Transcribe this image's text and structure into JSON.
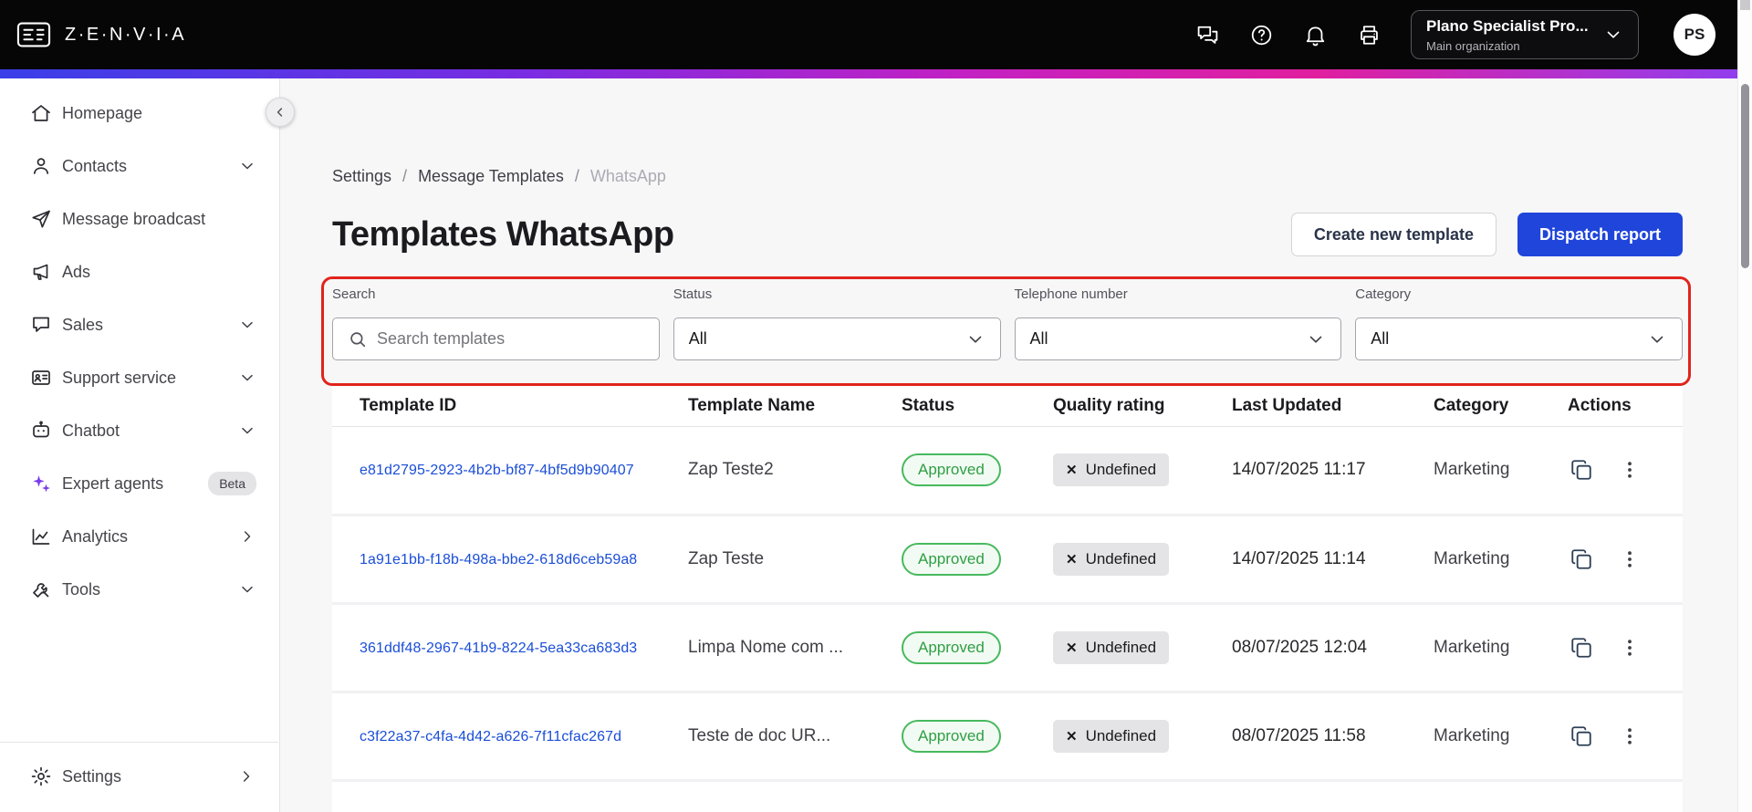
{
  "topbar": {
    "logo_text": "Z·E·N·V·I·A",
    "org_name": "Plano Specialist Pro...",
    "org_sub": "Main organization",
    "avatar_initials": "PS"
  },
  "sidebar": {
    "items": [
      {
        "label": "Homepage"
      },
      {
        "label": "Contacts"
      },
      {
        "label": "Message broadcast"
      },
      {
        "label": "Ads"
      },
      {
        "label": "Sales"
      },
      {
        "label": "Support service"
      },
      {
        "label": "Chatbot"
      },
      {
        "label": "Expert agents",
        "badge": "Beta"
      },
      {
        "label": "Analytics"
      },
      {
        "label": "Tools"
      }
    ],
    "settings_label": "Settings"
  },
  "breadcrumb": {
    "items": [
      "Settings",
      "Message Templates",
      "WhatsApp"
    ],
    "separator": "/"
  },
  "page": {
    "title": "Templates WhatsApp",
    "create_button_label": "Create new template",
    "dispatch_button_label": "Dispatch report"
  },
  "filters": {
    "search": {
      "label": "Search",
      "placeholder": "Search templates"
    },
    "status": {
      "label": "Status",
      "value": "All"
    },
    "telephone": {
      "label": "Telephone number",
      "value": "All"
    },
    "category": {
      "label": "Category",
      "value": "All"
    }
  },
  "table": {
    "headers": [
      "Template ID",
      "Template Name",
      "Status",
      "Quality rating",
      "Last Updated",
      "Category",
      "Actions"
    ],
    "rows": [
      {
        "id": "e81d2795-2923-4b2b-bf87-4bf5d9b90407",
        "name": "Zap Teste2",
        "status": "Approved",
        "quality": "Undefined",
        "updated": "14/07/2025 11:17",
        "category": "Marketing"
      },
      {
        "id": "1a91e1bb-f18b-498a-bbe2-618d6ceb59a8",
        "name": "Zap Teste",
        "status": "Approved",
        "quality": "Undefined",
        "updated": "14/07/2025 11:14",
        "category": "Marketing"
      },
      {
        "id": "361ddf48-2967-41b9-8224-5ea33ca683d3",
        "name": "Limpa Nome com ...",
        "status": "Approved",
        "quality": "Undefined",
        "updated": "08/07/2025 12:04",
        "category": "Marketing"
      },
      {
        "id": "c3f22a37-c4fa-4d42-a626-7f11cfac267d",
        "name": "Teste de doc UR...",
        "status": "Approved",
        "quality": "Undefined",
        "updated": "08/07/2025 11:58",
        "category": "Marketing"
      }
    ]
  },
  "icons": {
    "x_glyph": "✕"
  },
  "colors": {
    "primary_blue": "#2045db",
    "link_blue": "#1b4ed8",
    "approved_green": "#2f9e44",
    "annotation_red": "#e0241c",
    "topbar_black": "#060607",
    "gradient": [
      "#3a3fe8",
      "#7a2ce2",
      "#c321c3",
      "#e01f9f",
      "#8f3ff0"
    ]
  }
}
